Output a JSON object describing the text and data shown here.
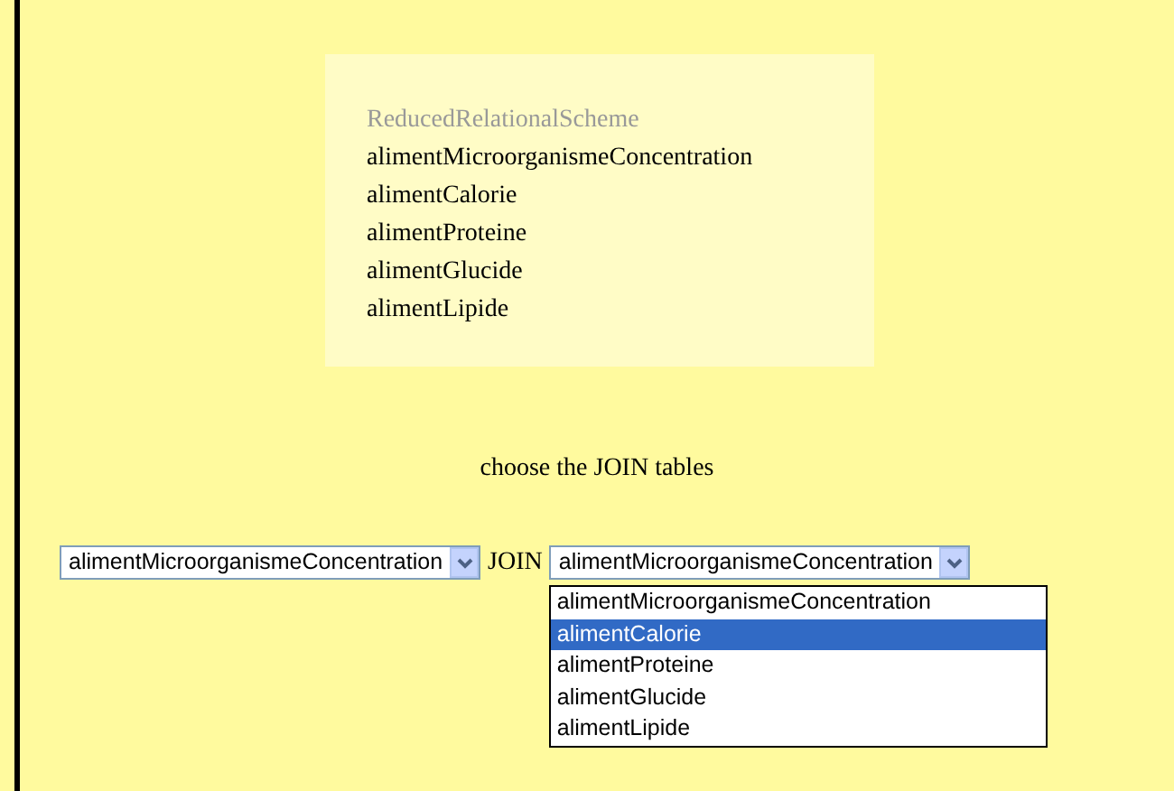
{
  "scheme": {
    "title": "ReducedRelationalScheme",
    "tables": [
      "alimentMicroorganismeConcentration",
      "alimentCalorie",
      "alimentProteine",
      "alimentGlucide",
      "alimentLipide"
    ]
  },
  "prompt": "choose the JOIN tables",
  "left_select": {
    "value": "alimentMicroorganismeConcentration"
  },
  "join_label": "JOIN",
  "right_select": {
    "value": "alimentMicroorganismeConcentration",
    "expanded": true,
    "options": [
      {
        "label": "alimentMicroorganismeConcentration",
        "highlighted": false
      },
      {
        "label": "alimentCalorie",
        "highlighted": true
      },
      {
        "label": "alimentProteine",
        "highlighted": false
      },
      {
        "label": "alimentGlucide",
        "highlighted": false
      },
      {
        "label": "alimentLipide",
        "highlighted": false
      }
    ]
  }
}
